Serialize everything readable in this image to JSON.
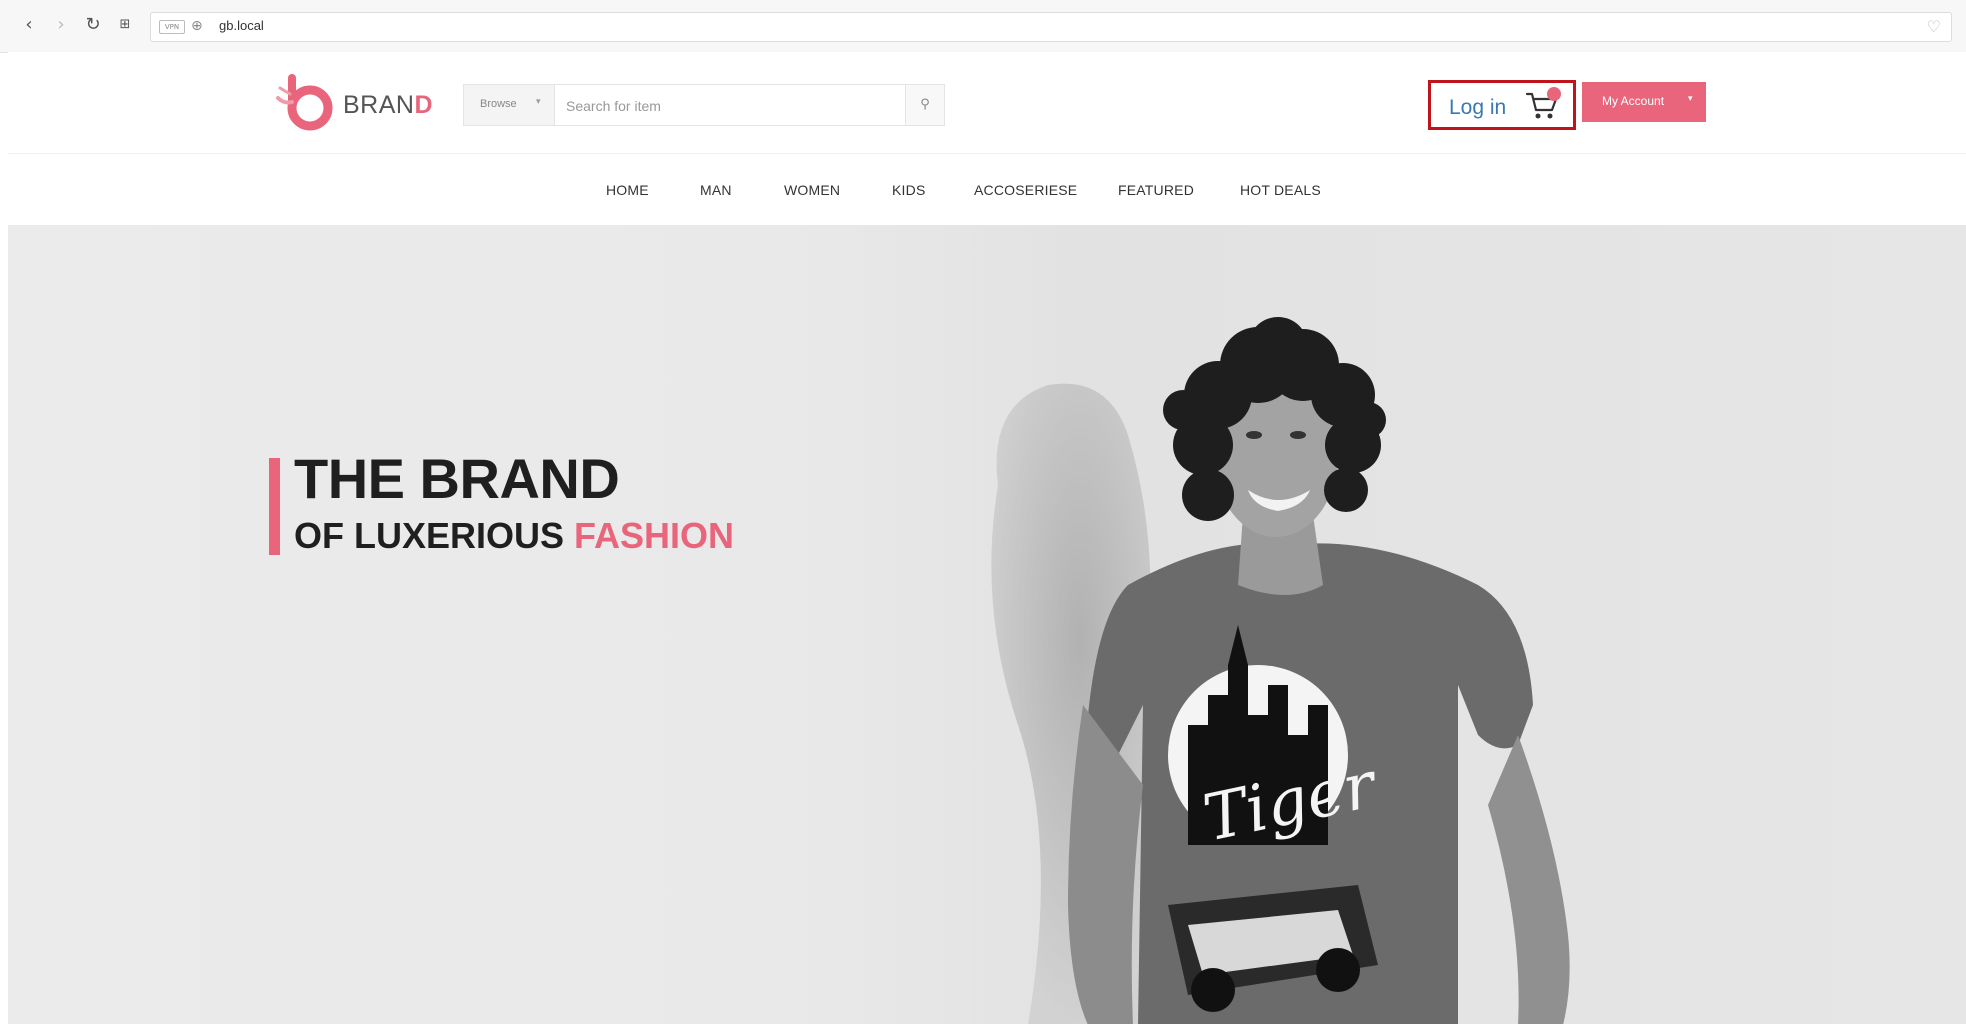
{
  "browser": {
    "url": "gb.local"
  },
  "header": {
    "brand_prefix": "BRAN",
    "brand_accent": "D",
    "search": {
      "category": "Browse",
      "placeholder": "Search for item"
    },
    "login_label": "Log in",
    "account_label": "My Account"
  },
  "nav": {
    "items": [
      "HOME",
      "MAN",
      "WOMEN",
      "KIDS",
      "ACCOSERIESE",
      "FEATURED",
      "HOT DEALS"
    ]
  },
  "hero": {
    "title": "THE BRAND",
    "subtitle_prefix": "OF LUXERIOUS ",
    "subtitle_accent": "FASHION",
    "shirt_text": "Tiger"
  },
  "colors": {
    "accent": "#e8657b",
    "login_link": "#3a78b5",
    "highlight_box": "#c0141c"
  }
}
